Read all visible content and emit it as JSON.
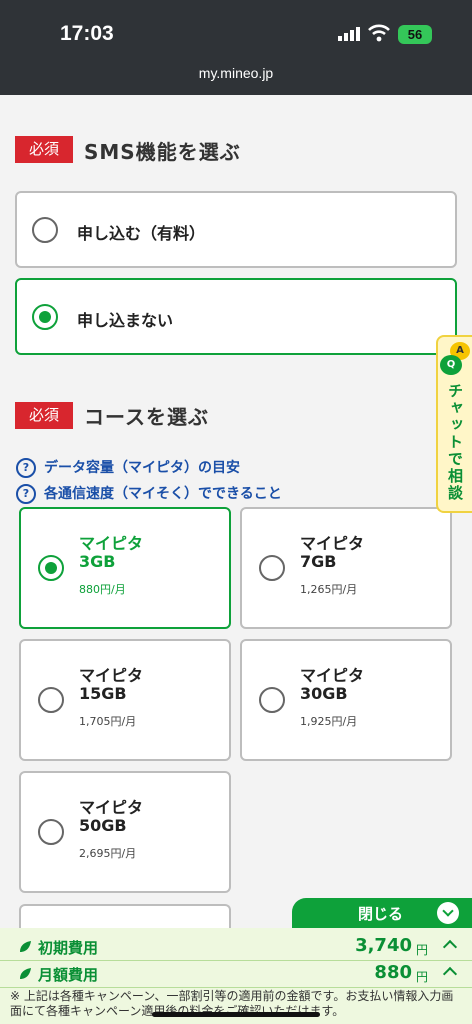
{
  "status_bar": {
    "time": "17:03",
    "battery": "56",
    "url": "my.mineo.jp"
  },
  "sms_section": {
    "badge": "必須",
    "title": "SMS機能を選ぶ",
    "options": [
      {
        "label": "申し込む（有料）",
        "selected": false
      },
      {
        "label": "申し込まない",
        "selected": true
      }
    ]
  },
  "course_section": {
    "badge": "必須",
    "title": "コースを選ぶ",
    "help_links": [
      "データ容量（マイピタ）の目安",
      "各通信速度（マイそく）でできること"
    ],
    "plans": [
      {
        "name": "マイピタ",
        "size": "3GB",
        "price": "880円/月",
        "selected": true
      },
      {
        "name": "マイピタ",
        "size": "7GB",
        "price": "1,265円/月",
        "selected": false
      },
      {
        "name": "マイピタ",
        "size": "15GB",
        "price": "1,705円/月",
        "selected": false
      },
      {
        "name": "マイピタ",
        "size": "30GB",
        "price": "1,925円/月",
        "selected": false
      },
      {
        "name": "マイピタ",
        "size": "50GB",
        "price": "2,695円/月",
        "selected": false
      }
    ]
  },
  "chat_tab": {
    "label": "チャットで相談",
    "icon_a": "A",
    "icon_q": "Q"
  },
  "summary": {
    "close_label": "閉じる",
    "initial_cost_label": "初期費用",
    "initial_cost_value": "3,740",
    "monthly_cost_label": "月額費用",
    "monthly_cost_value": "880",
    "unit": "円",
    "note": "※ 上記は各種キャンペーン、一部割引等の適用前の金額です。お支払い情報入力画面にて各種キャンペーン適用後の料金をご確認いただけます。"
  },
  "colors": {
    "accent_green": "#0ea13a",
    "required_red": "#d8262e",
    "link_blue": "#1a4fa8",
    "status_bar": "#2f3337"
  }
}
